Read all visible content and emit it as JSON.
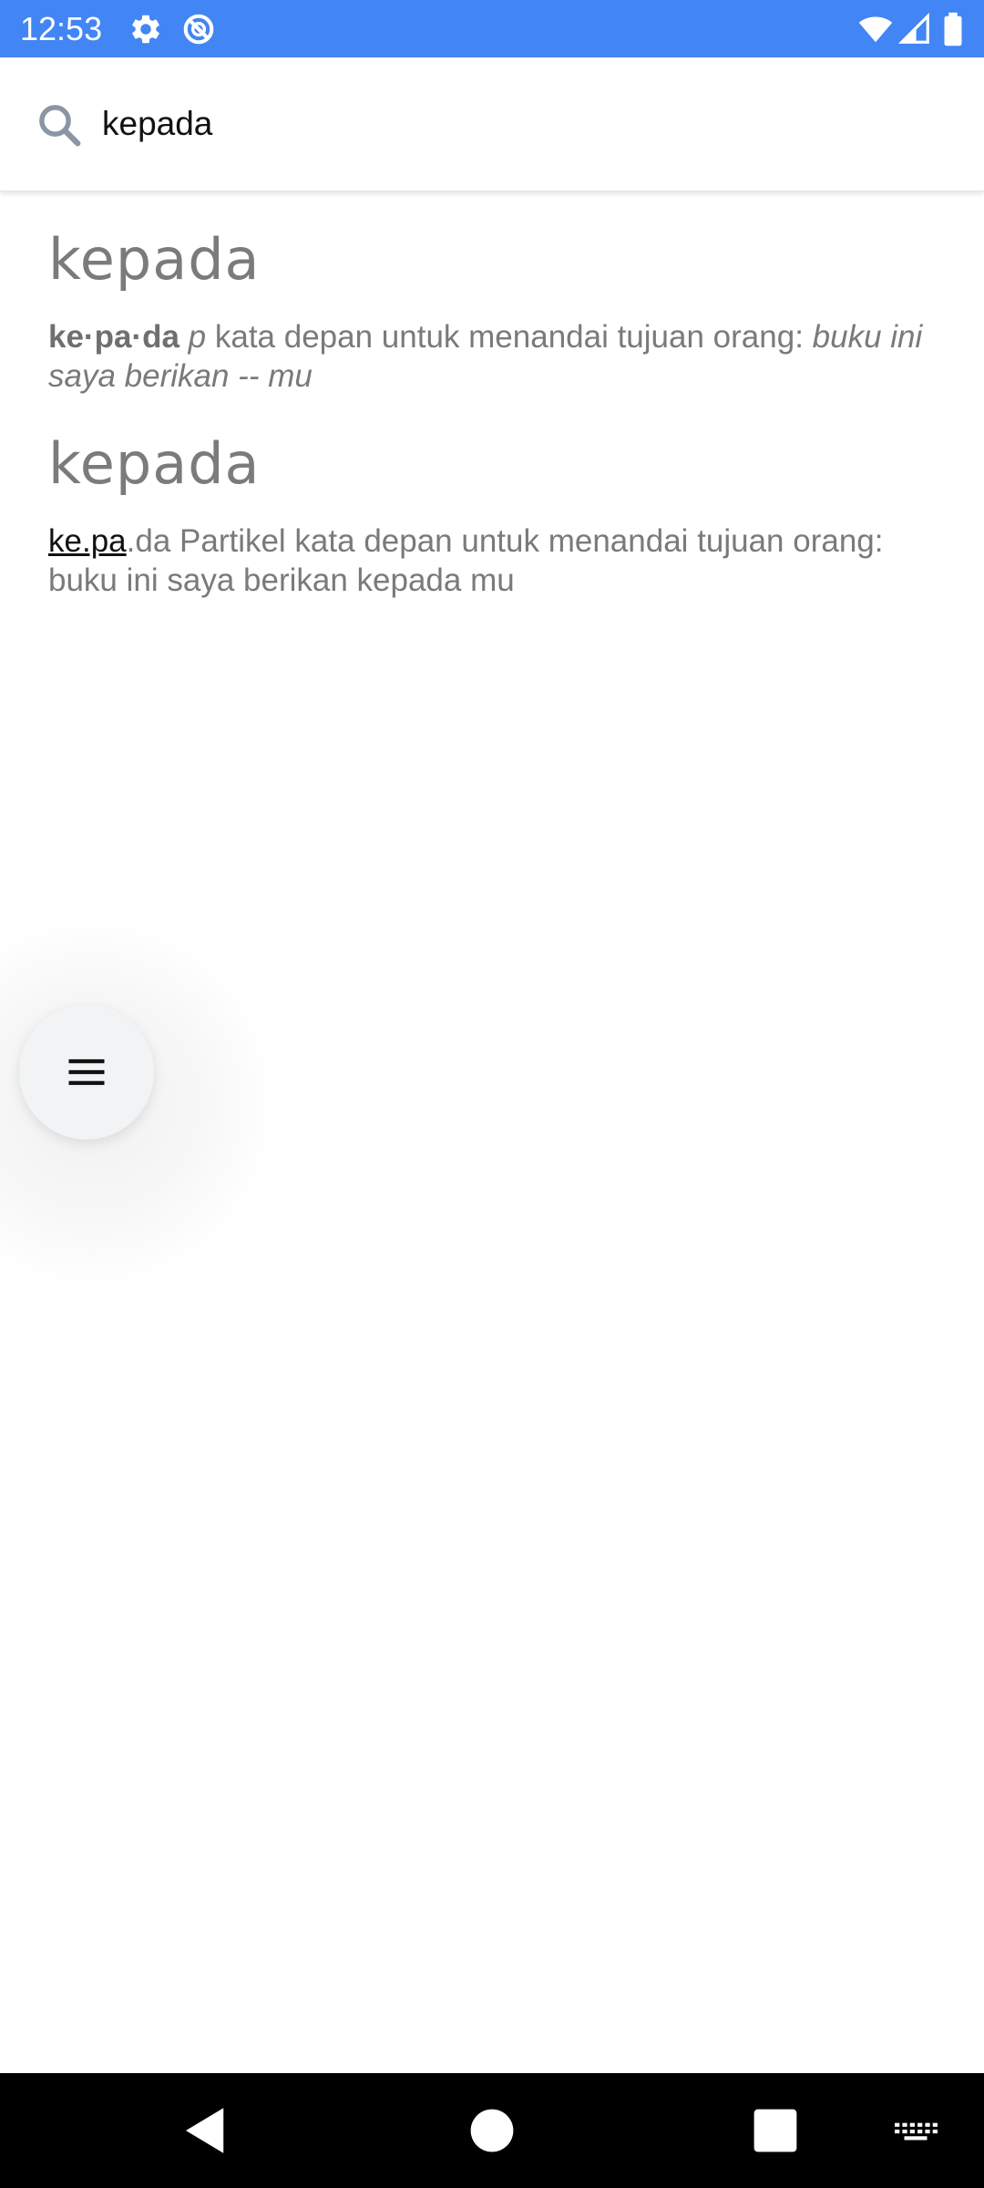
{
  "status_bar": {
    "time": "12:53",
    "background_color": "#4285f4",
    "icons": [
      "settings-icon",
      "do-not-disturb-icon",
      "wifi-icon",
      "cell-signal-icon",
      "battery-icon"
    ]
  },
  "search": {
    "query": "kepada",
    "icon": "search-icon"
  },
  "entries": [
    {
      "title": "kepada",
      "syllables": "ke·pa·da",
      "pos": "p",
      "definition": " kata depan untuk menandai tujuan orang: ",
      "example": "buku ini saya berikan -- mu"
    },
    {
      "title": "kepada",
      "syllable_link": "ke.pa",
      "rest": ".da Partikel kata depan untuk menandai tujuan orang: buku ini saya berikan kepada mu"
    }
  ],
  "fab": {
    "icon": "menu-icon"
  },
  "nav_bar": {
    "icons": [
      "back-icon",
      "home-icon",
      "recents-icon",
      "keyboard-icon"
    ]
  }
}
